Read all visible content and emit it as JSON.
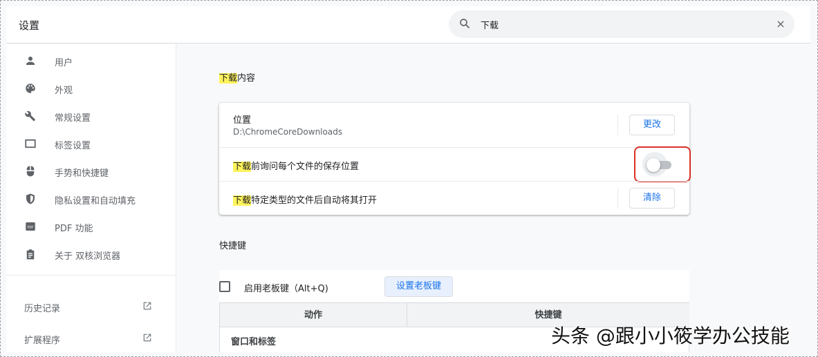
{
  "header": {
    "title": "设置",
    "search": {
      "value": "下载",
      "close_symbol": "×"
    }
  },
  "sidebar": {
    "items": [
      {
        "label": "用户",
        "icon": "person-icon"
      },
      {
        "label": "外观",
        "icon": "palette-icon"
      },
      {
        "label": "常规设置",
        "icon": "wrench-icon"
      },
      {
        "label": "标签设置",
        "icon": "tab-icon"
      },
      {
        "label": "手势和快捷键",
        "icon": "mouse-icon"
      },
      {
        "label": "隐私设置和自动填充",
        "icon": "shield-icon"
      },
      {
        "label": "PDF 功能",
        "icon": "pdf-icon"
      },
      {
        "label": "关于 双核浏览器",
        "icon": "clipboard-icon"
      }
    ],
    "external": [
      {
        "label": "历史记录",
        "icon": "open-in-new-icon"
      },
      {
        "label": "扩展程序",
        "icon": "open-in-new-icon"
      }
    ]
  },
  "main": {
    "downloads": {
      "title_highlight": "下载",
      "title_rest": "内容",
      "location": {
        "label": "位置",
        "path": "D:\\ChromeCoreDownloads",
        "button": "更改"
      },
      "ask": {
        "highlight": "下载",
        "rest": "前询问每个文件的保存位置",
        "enabled": false
      },
      "auto_open": {
        "highlight": "下载",
        "rest": "特定类型的文件后自动将其打开",
        "button": "清除"
      }
    },
    "shortcuts": {
      "title": "快捷键",
      "boss_key": {
        "label": "启用老板键（Alt+Q)",
        "checked": false,
        "button": "设置老板键"
      },
      "table": {
        "headers": [
          "动作",
          "快捷键"
        ],
        "group": "窗口和标签"
      }
    }
  },
  "watermark": "头条 @跟小小筱学办公技能",
  "colors": {
    "highlight": "#fff35c",
    "accent": "#1a73e8",
    "callout": "#d93025"
  }
}
